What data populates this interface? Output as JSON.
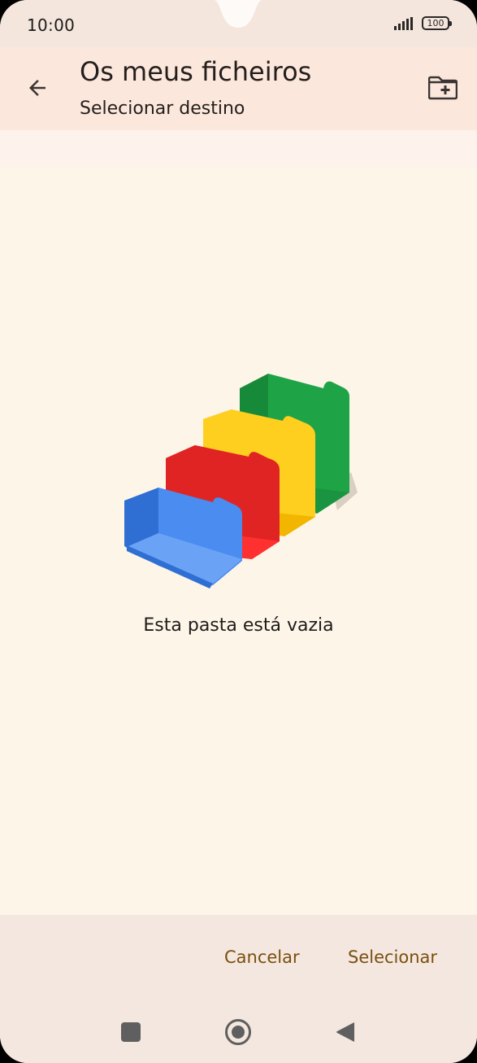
{
  "status_bar": {
    "time": "10:00",
    "battery": "100",
    "signal_icon": "cell-signal-icon",
    "battery_icon": "battery-icon"
  },
  "app_bar": {
    "back_icon": "arrow-back-icon",
    "title": "Os meus ficheiros",
    "subtitle": "Selecionar destino",
    "new_folder_icon": "create-new-folder-icon"
  },
  "empty_state": {
    "illustration": "empty-folders-illustration",
    "message": "Esta pasta está vazia"
  },
  "actions": {
    "cancel_label": "Cancelar",
    "select_label": "Selecionar"
  },
  "nav_bar": {
    "recent_icon": "recent-apps-icon",
    "home_icon": "home-icon",
    "back_icon": "nav-back-icon"
  },
  "colors": {
    "background": "#fdf5e8",
    "app_bar": "#fce7dc",
    "bottom_panel": "#f4e7df",
    "action_text": "#7a4f0f",
    "folder_blue": "#4285f4",
    "folder_red": "#db3236",
    "folder_yellow": "#f4c20d",
    "folder_green": "#1ea446"
  }
}
